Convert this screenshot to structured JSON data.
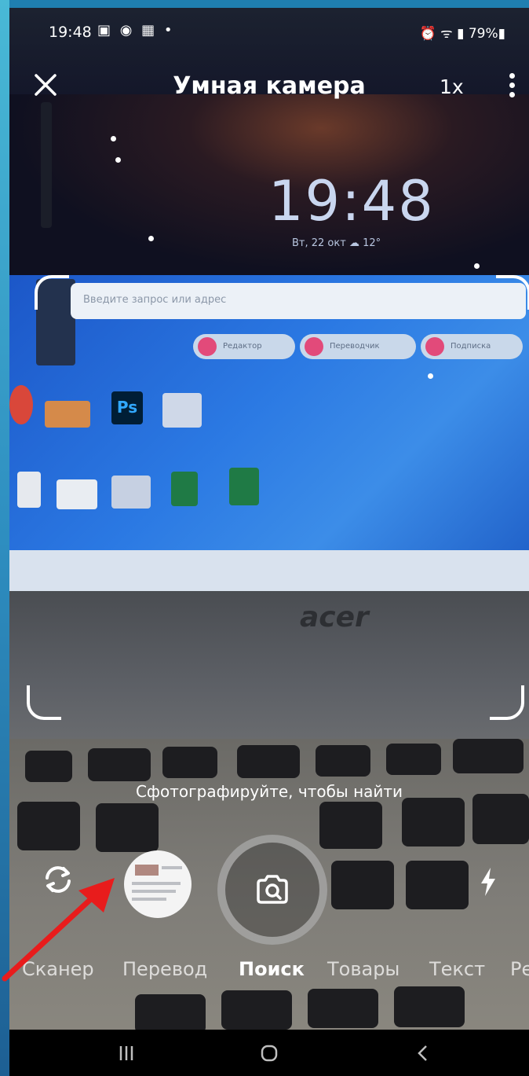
{
  "status_bar": {
    "time": "19:48",
    "left_icons": "▣ ◉ ▦ •",
    "right_icons": "⏰ ᯤ ▮ 79%▮"
  },
  "top_bar": {
    "title": "Умная камера",
    "zoom": "1x"
  },
  "scene": {
    "clock": "19:48",
    "date": "Вт, 22 окт ☁ 12°",
    "search_placeholder": "Введите запрос или адрес",
    "pills": [
      "Редактор",
      "Переводчик",
      "Подписка"
    ],
    "brand": "acer"
  },
  "hint": "Сфотографируйте, чтобы найти",
  "modes": [
    {
      "label": "Сканер"
    },
    {
      "label": "Перевод"
    },
    {
      "label": "Поиск"
    },
    {
      "label": "Товары"
    },
    {
      "label": "Текст"
    },
    {
      "label": "Ре"
    }
  ],
  "active_mode": "Поиск",
  "colors": {
    "arrow": "#e81c1c",
    "frame": "#ffffff",
    "desktop": "#2b79e3"
  },
  "icons": [
    "close-icon",
    "more-icon",
    "rotate-camera-icon",
    "gallery-thumbnail",
    "camera-search-icon",
    "flash-icon",
    "recents-icon",
    "home-icon",
    "back-icon"
  ]
}
